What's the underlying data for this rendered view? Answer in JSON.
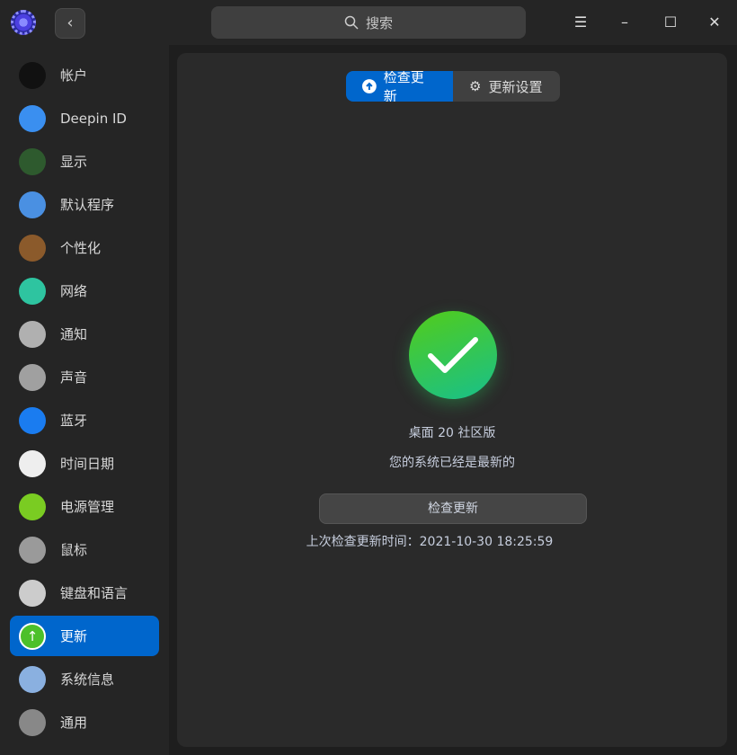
{
  "header": {
    "search_placeholder": "搜索"
  },
  "sidebar": {
    "items": [
      {
        "label": "帐户",
        "icon": "account-icon",
        "color": "#111111"
      },
      {
        "label": "Deepin ID",
        "icon": "cloud-icon",
        "color": "#3a8ff0"
      },
      {
        "label": "显示",
        "icon": "display-icon",
        "color": "#2e5a2e"
      },
      {
        "label": "默认程序",
        "icon": "default-apps-icon",
        "color": "#4a90e2"
      },
      {
        "label": "个性化",
        "icon": "palette-icon",
        "color": "#8b5a2b"
      },
      {
        "label": "网络",
        "icon": "network-icon",
        "color": "#2ec4a0"
      },
      {
        "label": "通知",
        "icon": "bell-icon",
        "color": "#b0b0b0"
      },
      {
        "label": "声音",
        "icon": "speaker-icon",
        "color": "#a0a0a0"
      },
      {
        "label": "蓝牙",
        "icon": "bluetooth-icon",
        "color": "#1a7cf0"
      },
      {
        "label": "时间日期",
        "icon": "clock-icon",
        "color": "#eeeeee"
      },
      {
        "label": "电源管理",
        "icon": "battery-icon",
        "color": "#7acc22"
      },
      {
        "label": "鼠标",
        "icon": "mouse-icon",
        "color": "#9a9a9a"
      },
      {
        "label": "键盘和语言",
        "icon": "keyboard-icon",
        "color": "#cccccc"
      },
      {
        "label": "更新",
        "icon": "update-icon",
        "color": "#4cc02a",
        "active": true
      },
      {
        "label": "系统信息",
        "icon": "system-info-icon",
        "color": "#8ab0e0"
      },
      {
        "label": "通用",
        "icon": "general-icon",
        "color": "#888888"
      }
    ]
  },
  "main": {
    "tabs": [
      {
        "label": "检查更新"
      },
      {
        "label": "更新设置"
      }
    ],
    "edition": "桌面 20 社区版",
    "status": "您的系统已经是最新的",
    "check_button": "检查更新",
    "last_check": "上次检查更新时间：2021-10-30 18:25:59"
  },
  "colors": {
    "accent": "#0066cc",
    "success": "#3cc650"
  }
}
